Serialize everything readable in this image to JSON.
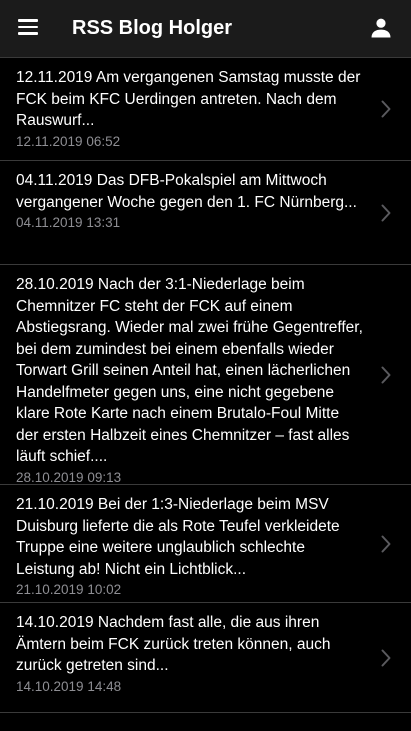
{
  "header": {
    "title": "RSS Blog Holger",
    "menu_icon": "menu-icon",
    "user_icon": "account-icon"
  },
  "colors": {
    "background": "#000000",
    "appbar": "#1b1b1b",
    "divider": "#3a3a3a",
    "date_text": "#8e8e93",
    "chevron": "#5a5a5e"
  },
  "feed": {
    "items": [
      {
        "text": "12.11.2019 Am vergangenen Samstag musste der FCK beim KFC Uerdingen antreten. Nach dem Rauswurf...",
        "date": "12.11.2019 06:52"
      },
      {
        "text": "04.11.2019 Das DFB-Pokalspiel am Mittwoch vergangener Woche gegen den 1. FC Nürnberg...",
        "date": "04.11.2019 13:31"
      },
      {
        "text": "28.10.2019 Nach der 3:1-Niederlage beim Chemnitzer FC steht der FCK auf einem Abstiegsrang. Wieder mal zwei frühe Gegentreffer, bei dem zumindest bei einem ebenfalls wieder Torwart Grill seinen Anteil hat, einen lächerlichen Handelfmeter gegen uns, eine nicht gegebene klare Rote Karte nach einem Brutalo-Foul Mitte der ersten Halbzeit eines Chemnitzer – fast alles läuft schief....",
        "date": "28.10.2019 09:13"
      },
      {
        "text": "21.10.2019 Bei der 1:3-Niederlage beim MSV Duisburg lieferte die als Rote Teufel verkleidete Truppe eine weitere unglaublich schlechte Leistung ab! Nicht ein Lichtblick...",
        "date": "21.10.2019 10:02"
      },
      {
        "text": "14.10.2019 Nachdem fast alle, die aus ihren Ämtern beim FCK zurück treten können, auch zurück getreten sind...",
        "date": "14.10.2019 14:48"
      }
    ]
  }
}
